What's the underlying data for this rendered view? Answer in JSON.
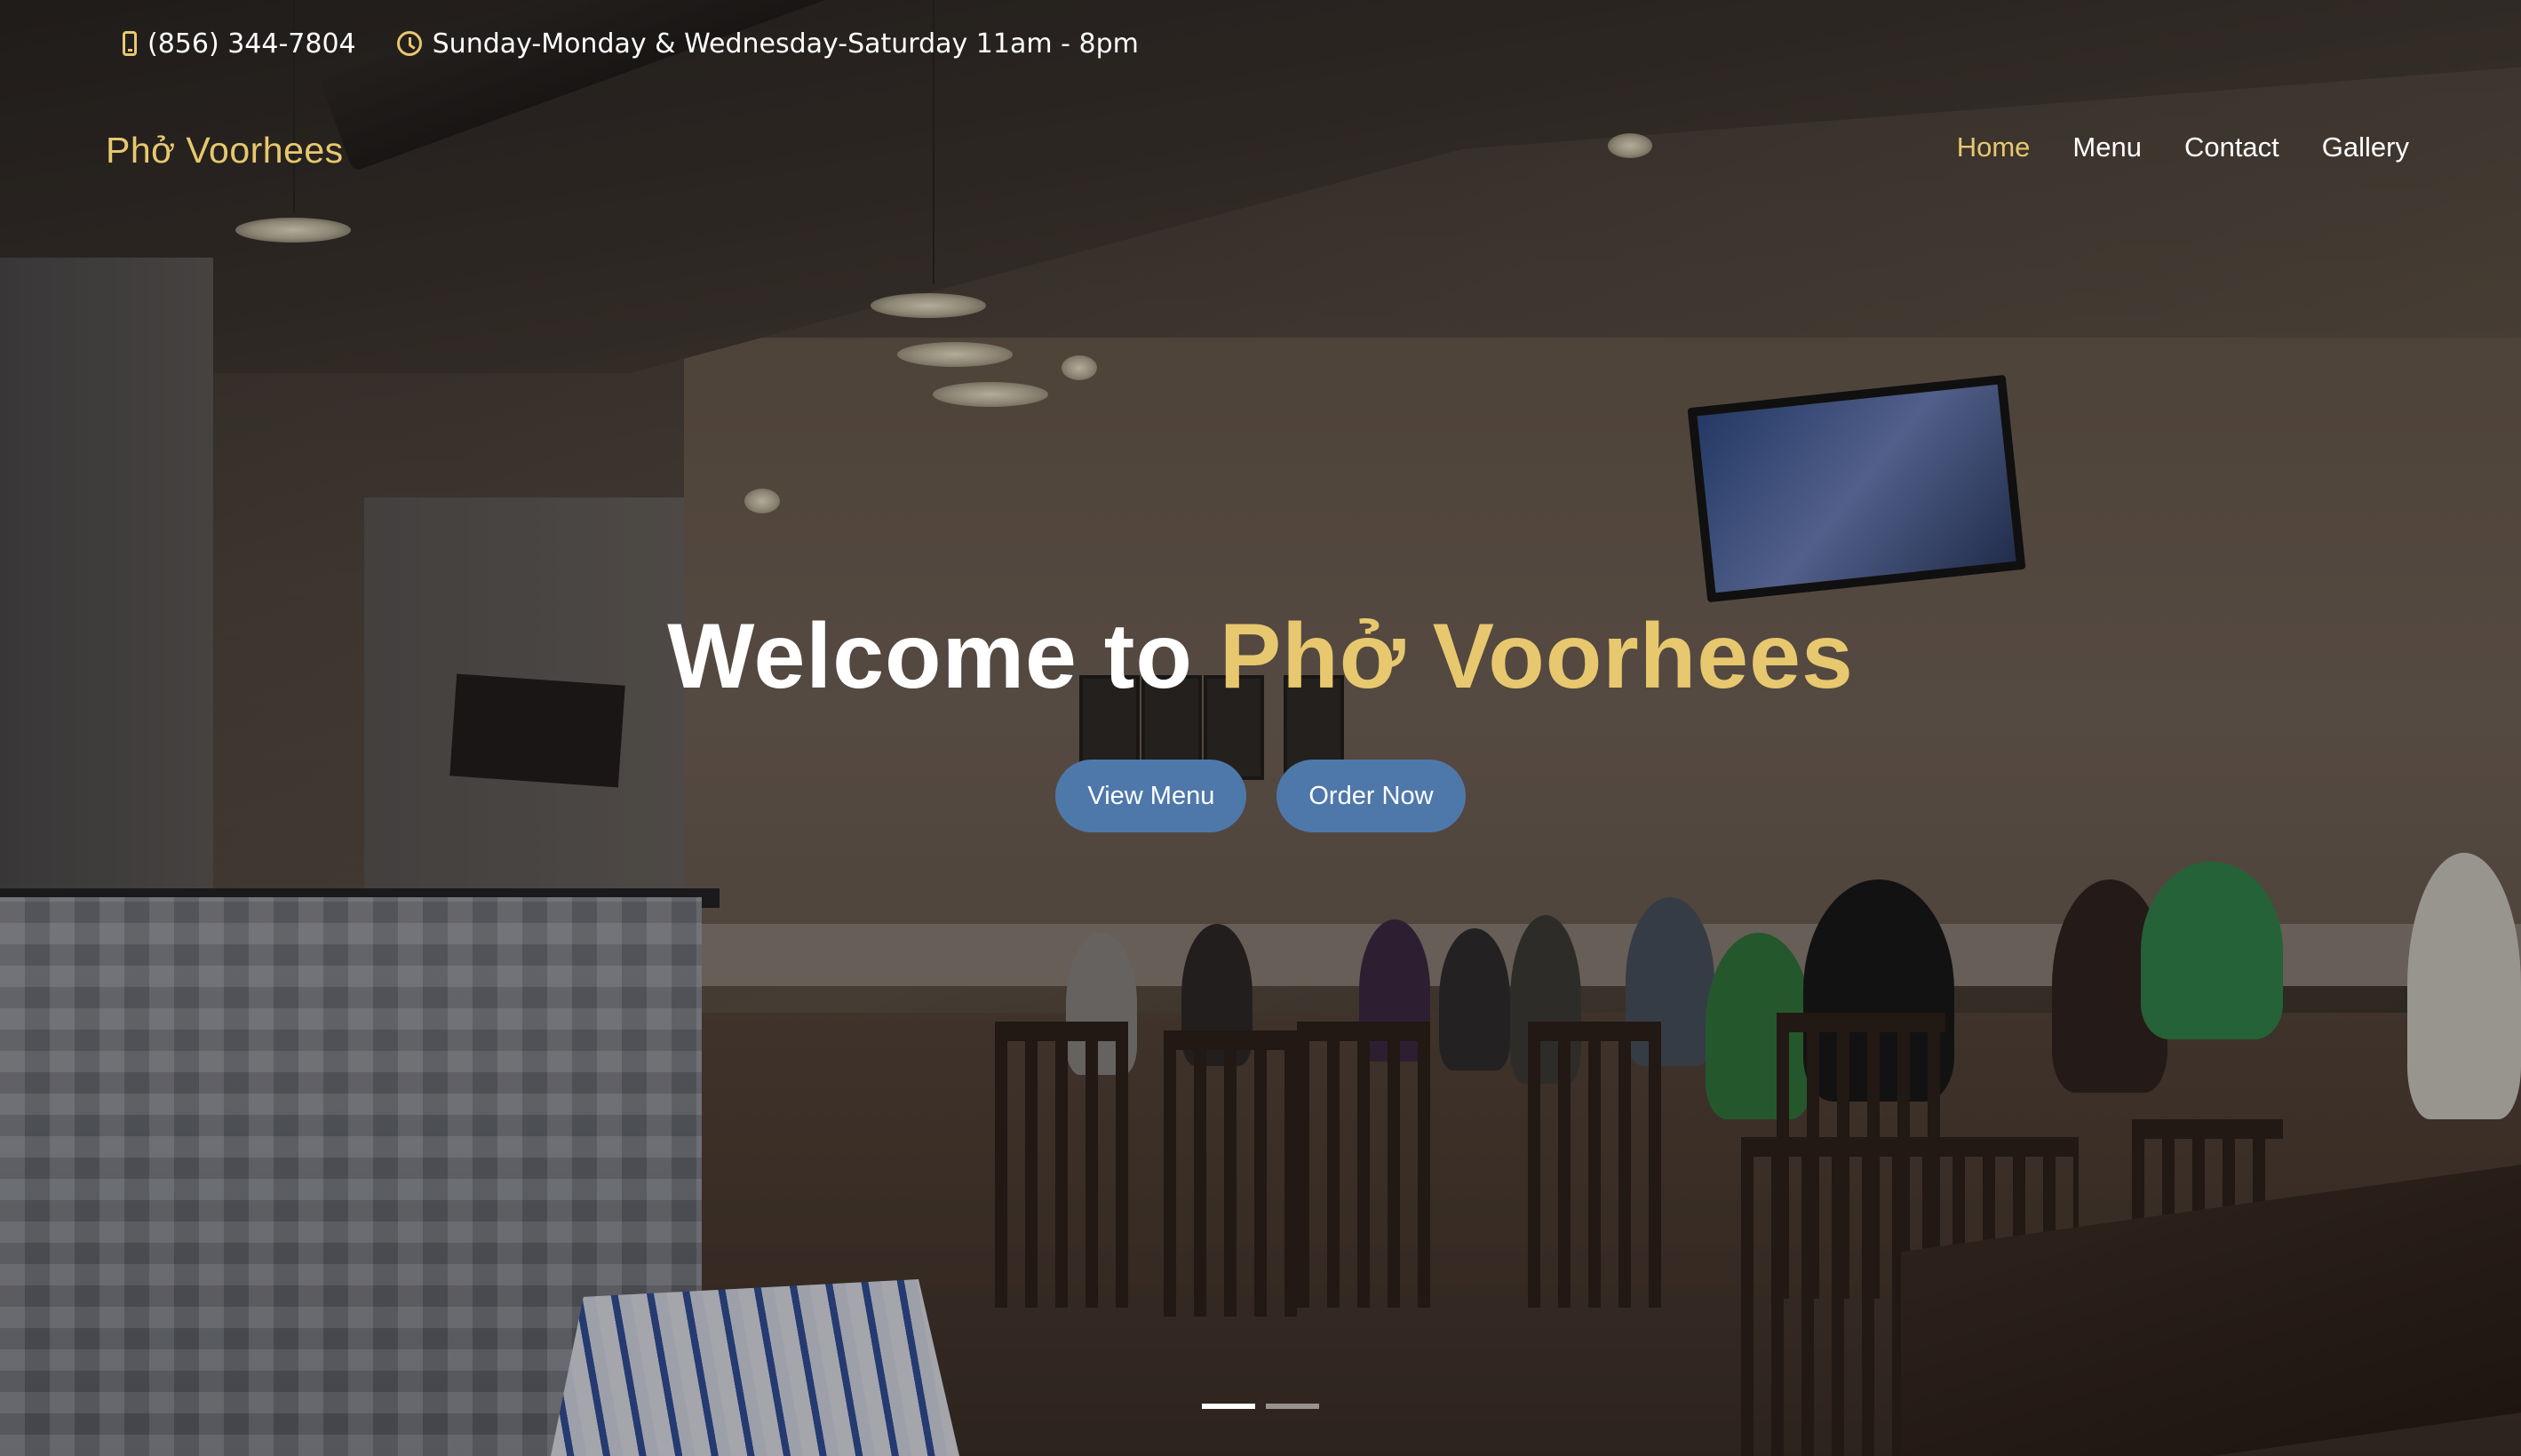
{
  "topbar": {
    "phone": "(856) 344-7804",
    "phone_icon": "phone-icon",
    "hours": "Sunday-Monday & Wednesday-Saturday 11am - 8pm",
    "hours_icon": "clock-icon"
  },
  "header": {
    "brand": "Phở Voorhees",
    "nav": [
      {
        "label": "Home",
        "active": true
      },
      {
        "label": "Menu",
        "active": false
      },
      {
        "label": "Contact",
        "active": false
      },
      {
        "label": "Gallery",
        "active": false
      }
    ]
  },
  "hero": {
    "title_prefix": "Welcome to ",
    "title_accent": "Phở Voorhees",
    "buttons": [
      {
        "label": "View Menu"
      },
      {
        "label": "Order Now"
      }
    ],
    "slides": {
      "count": 2,
      "active": 1
    }
  },
  "colors": {
    "accent": "#e7c86f",
    "button": "#4f78aa",
    "text": "#ffffff"
  }
}
